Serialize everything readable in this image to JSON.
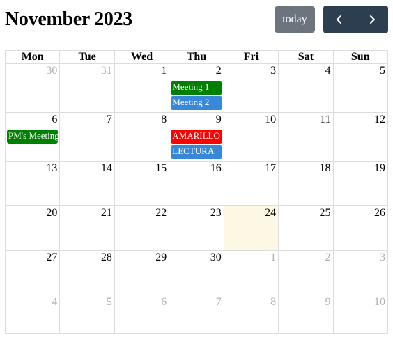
{
  "header": {
    "title": "November 2023",
    "today_label": "today",
    "prev_icon": "chevron-left-icon",
    "next_icon": "chevron-right-icon"
  },
  "weekdays": [
    "Mon",
    "Tue",
    "Wed",
    "Thu",
    "Fri",
    "Sat",
    "Sun"
  ],
  "weeks": [
    [
      "30",
      "31",
      "1",
      "2",
      "3",
      "4",
      "5"
    ],
    [
      "6",
      "7",
      "8",
      "9",
      "10",
      "11",
      "12"
    ],
    [
      "13",
      "14",
      "15",
      "16",
      "17",
      "18",
      "19"
    ],
    [
      "20",
      "21",
      "22",
      "23",
      "24",
      "25",
      "26"
    ],
    [
      "27",
      "28",
      "29",
      "30",
      "1",
      "2",
      "3"
    ],
    [
      "4",
      "5",
      "6",
      "7",
      "8",
      "9",
      "10"
    ]
  ],
  "events": [
    {
      "title": "Meeting 1",
      "color": "#008000"
    },
    {
      "title": "Meeting 2",
      "color": "#3788d8"
    },
    {
      "title": "PM's Meeting",
      "color": "#008000"
    },
    {
      "title": "AMARILLO",
      "color": "#ff0000"
    },
    {
      "title": "LECTURA",
      "color": "#3788d8"
    }
  ],
  "colors": {
    "today_button": "#6c757d",
    "nav_button": "#2c3e50",
    "today_cell": "#fcf8e3",
    "border": "#dddddd",
    "other_month_text": "#b0b0b0"
  }
}
